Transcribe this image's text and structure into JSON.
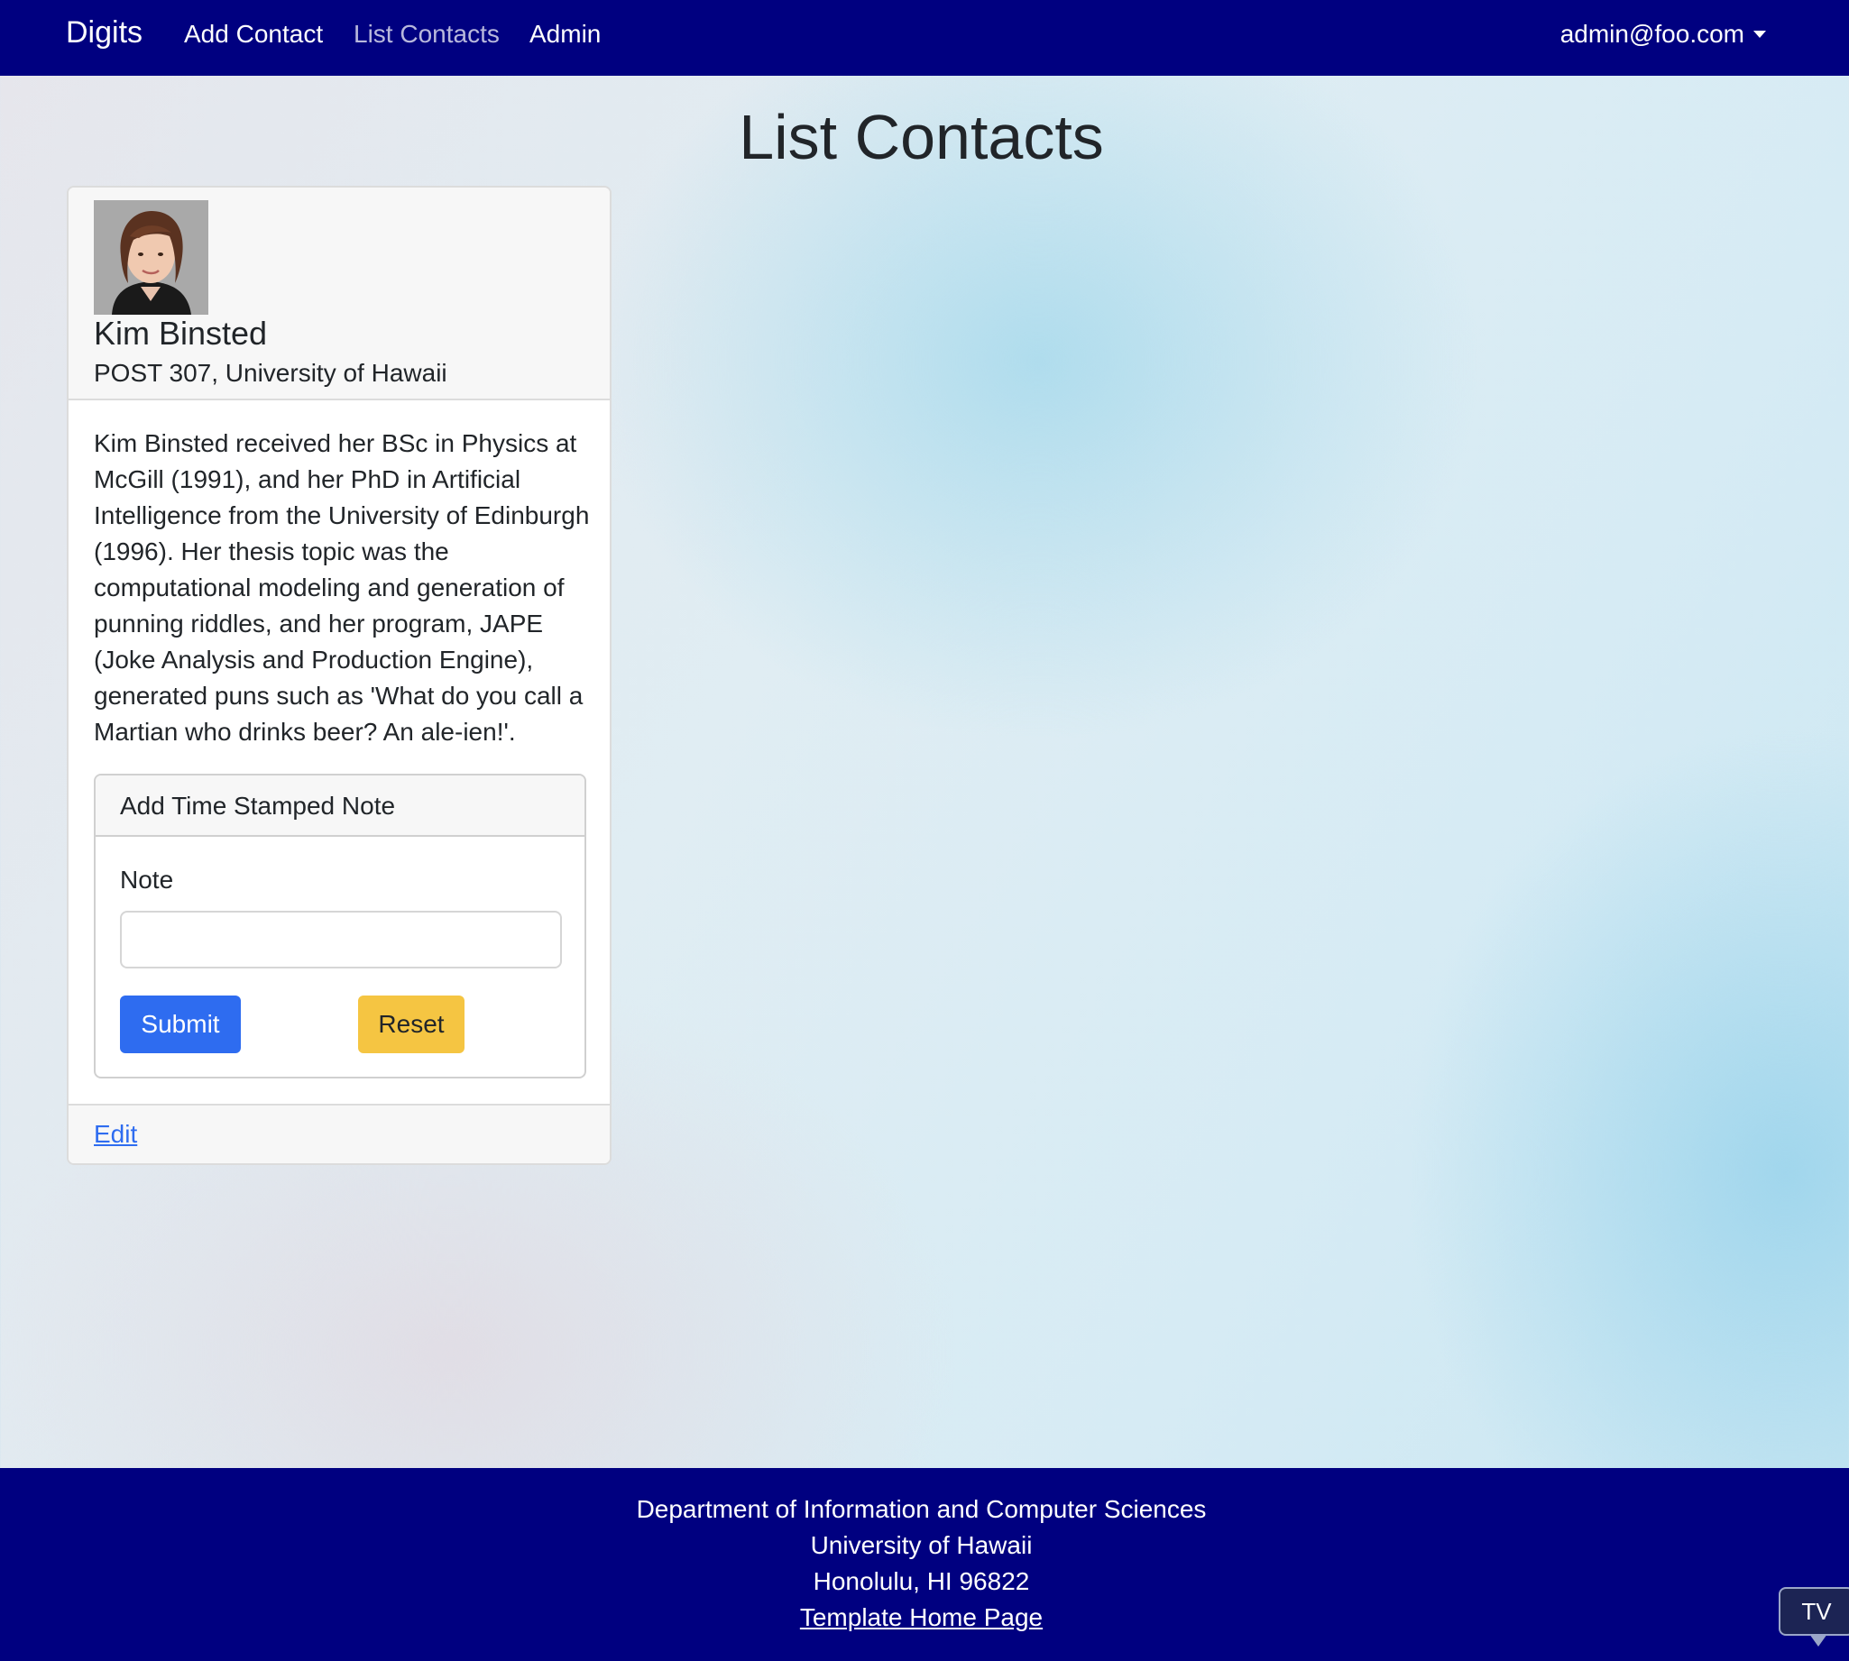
{
  "navbar": {
    "brand": "Digits",
    "links": [
      "Add Contact",
      "List Contacts",
      "Admin"
    ],
    "active": "List Contacts",
    "user": "admin@foo.com",
    "background_color": "#000080"
  },
  "page": {
    "title": "List Contacts"
  },
  "contact": {
    "name": "Kim Binsted",
    "address": "POST 307, University of Hawaii",
    "description": "Kim Binsted received her BSc in Physics at McGill (1991), and her PhD in Artificial Intelligence from the University of Edinburgh (1996). Her thesis topic was the computational modeling and generation of punning riddles, and her program, JAPE (Joke Analysis and Production Engine), generated puns such as 'What do you call a Martian who drinks beer? An ale-ien!'.",
    "edit_label": "Edit"
  },
  "note_form": {
    "title": "Add Time Stamped Note",
    "label": "Note",
    "value": "",
    "submit_label": "Submit",
    "reset_label": "Reset",
    "submit_color": "#2e6cf0",
    "reset_color": "#f5c542"
  },
  "footer": {
    "line1": "Department of Information and Computer Sciences",
    "line2": "University of Hawaii",
    "line3": "Honolulu, HI 96822",
    "link": "Template Home Page"
  },
  "badge": {
    "label": "TV"
  }
}
